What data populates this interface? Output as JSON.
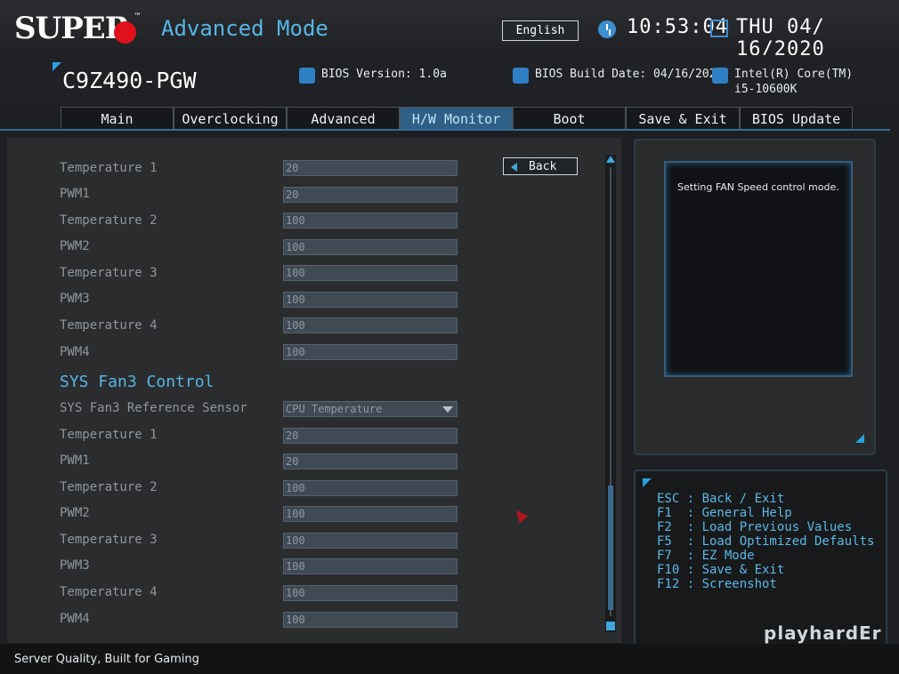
{
  "header": {
    "logo": "SUPER",
    "mode_title": "Advanced Mode",
    "language": "English",
    "time": "10:53:04",
    "date": "THU 04/ 16/2020"
  },
  "system": {
    "board": "C9Z490-PGW",
    "bios_version": "BIOS Version: 1.0a",
    "bios_build_date": "BIOS Build Date: 04/16/2020",
    "cpu_line1": "Intel(R) Core(TM)",
    "cpu_line2": "i5-10600K"
  },
  "tabs": [
    {
      "label": "Main"
    },
    {
      "label": "Overclocking"
    },
    {
      "label": "Advanced"
    },
    {
      "label": "H/W Monitor",
      "active": true
    },
    {
      "label": "Boot"
    },
    {
      "label": "Save & Exit"
    },
    {
      "label": "BIOS Update"
    }
  ],
  "back_label": "Back",
  "settings_top": [
    {
      "label": "Temperature 1",
      "value": "20"
    },
    {
      "label": "PWM1",
      "value": "20"
    },
    {
      "label": "Temperature 2",
      "value": "100"
    },
    {
      "label": "PWM2",
      "value": "100"
    },
    {
      "label": "Temperature 3",
      "value": "100"
    },
    {
      "label": "PWM3",
      "value": "100"
    },
    {
      "label": "Temperature 4",
      "value": "100"
    },
    {
      "label": "PWM4",
      "value": "100"
    }
  ],
  "section_heading": "SYS Fan3 Control",
  "reference_sensor": {
    "label": "SYS Fan3 Reference Sensor",
    "value": "CPU Temperature"
  },
  "settings_bottom": [
    {
      "label": "Temperature 1",
      "value": "20"
    },
    {
      "label": "PWM1",
      "value": "20"
    },
    {
      "label": "Temperature 2",
      "value": "100"
    },
    {
      "label": "PWM2",
      "value": "100"
    },
    {
      "label": "Temperature 3",
      "value": "100"
    },
    {
      "label": "PWM3",
      "value": "100"
    },
    {
      "label": "Temperature 4",
      "value": "100"
    },
    {
      "label": "PWM4",
      "value": "100"
    }
  ],
  "help_text": "Setting FAN Speed control mode.",
  "keys": [
    "ESC : Back / Exit",
    "F1  : General Help",
    "F2  : Load Previous Values",
    "F5  : Load Optimized Defaults",
    "F7  : EZ Mode",
    "F10 : Save & Exit",
    "F12 : Screenshot"
  ],
  "footer": {
    "slogan": "Server Quality, Built for Gaming",
    "watermark": "playhardEr"
  },
  "colors": {
    "accent": "#56b6e4",
    "logo_red": "#e0101c",
    "active_tab": "#2e5f86"
  }
}
